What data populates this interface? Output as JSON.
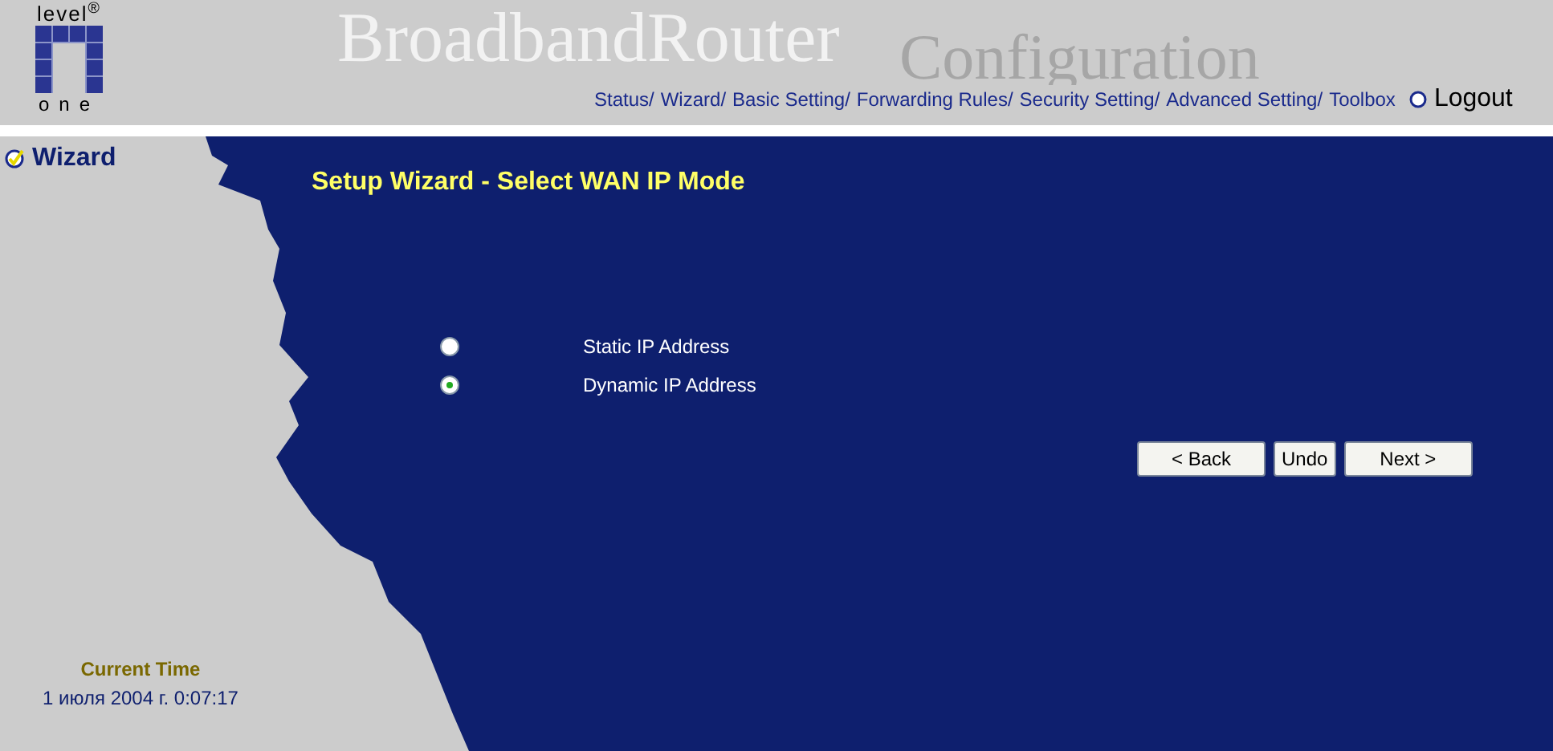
{
  "header": {
    "logo_top": "level$^{®}$",
    "logo_bottom": "one",
    "title": "BroadbandRouter",
    "subtitle": "Configuration",
    "nav": [
      {
        "label": "Status/"
      },
      {
        "label": "Wizard/"
      },
      {
        "label": "Basic Setting/"
      },
      {
        "label": "Forwarding Rules/"
      },
      {
        "label": "Security Setting/"
      },
      {
        "label": "Advanced Setting/"
      },
      {
        "label": "Toolbox"
      }
    ],
    "logout": "Logout"
  },
  "sidebar": {
    "items": [
      {
        "label": "Wizard",
        "selected": true
      }
    ],
    "clock": {
      "label": "Current Time",
      "value": "1 июля 2004 г. 0:07:17"
    }
  },
  "wizard": {
    "title": "Setup Wizard - Select WAN IP Mode",
    "options": [
      {
        "label": "Static IP Address",
        "selected": false
      },
      {
        "label": "Dynamic IP Address",
        "selected": true
      }
    ],
    "buttons": [
      {
        "label": "< Back"
      },
      {
        "label": "Undo"
      },
      {
        "label": "Next >"
      }
    ]
  }
}
